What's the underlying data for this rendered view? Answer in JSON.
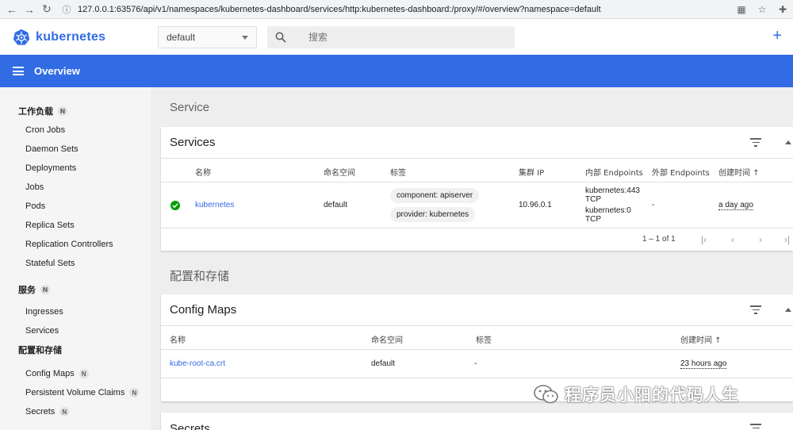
{
  "browser": {
    "url": "127.0.0.1:63576/api/v1/namespaces/kubernetes-dashboard/services/http:kubernetes-dashboard:/proxy/#/overview?namespace=default"
  },
  "header": {
    "brand": "kubernetes",
    "namespace": "default",
    "search_placeholder": "搜索",
    "plus": "+"
  },
  "toolbar": {
    "title": "Overview"
  },
  "sidebar": {
    "groups": [
      {
        "label": "工作负载",
        "badge": "N",
        "items": [
          {
            "label": "Cron Jobs"
          },
          {
            "label": "Daemon Sets"
          },
          {
            "label": "Deployments"
          },
          {
            "label": "Jobs"
          },
          {
            "label": "Pods"
          },
          {
            "label": "Replica Sets"
          },
          {
            "label": "Replication Controllers"
          },
          {
            "label": "Stateful Sets"
          }
        ]
      },
      {
        "label": "服务",
        "badge": "N",
        "items": [
          {
            "label": "Ingresses"
          },
          {
            "label": "Services"
          }
        ]
      },
      {
        "label": "配置和存储",
        "items": [
          {
            "label": "Config Maps",
            "badge": "N"
          },
          {
            "label": "Persistent Volume Claims",
            "badge": "N"
          },
          {
            "label": "Secrets",
            "badge": "N"
          }
        ]
      }
    ]
  },
  "service_section": {
    "title": "Service",
    "card_title": "Services",
    "columns": [
      "名称",
      "命名空间",
      "标签",
      "集群 IP",
      "内部 Endpoints",
      "外部 Endpoints",
      "创建时间 ↑"
    ],
    "row": {
      "name": "kubernetes",
      "namespace": "default",
      "labels": [
        "component: apiserver",
        "provider: kubernetes"
      ],
      "cluster_ip": "10.96.0.1",
      "internal_endpoints": [
        "kubernetes:443",
        "TCP",
        "kubernetes:0",
        "TCP"
      ],
      "external_endpoints": "-",
      "created": "a day ago"
    },
    "pagination": "1 – 1 of 1"
  },
  "config_section": {
    "title": "配置和存储",
    "card_title": "Config Maps",
    "columns": [
      "名称",
      "命名空间",
      "标签",
      "创建时间 ↑"
    ],
    "row": {
      "name": "kube-root-ca.crt",
      "namespace": "default",
      "labels": "-",
      "created": "23 hours ago"
    }
  },
  "secrets_section": {
    "card_title": "Secrets"
  },
  "watermark": {
    "text": "程序员小阳的代码人生"
  },
  "colors": {
    "accent": "#326ce5",
    "success": "#00a000"
  }
}
